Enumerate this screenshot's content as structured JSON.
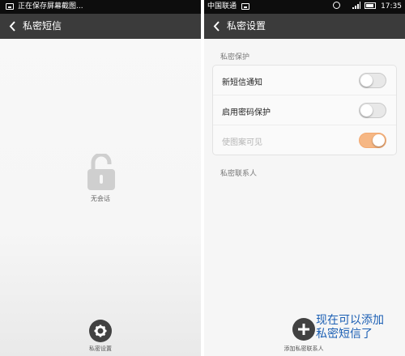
{
  "left": {
    "status_text": "正在保存屏幕截图...",
    "title": "私密短信",
    "empty_label": "无会话",
    "settings_label": "私密设置",
    "icons": {
      "lock": "unlocked-padlock-icon",
      "settings": "gear-icon",
      "back": "chevron-left-icon"
    }
  },
  "right": {
    "carrier": "中国联通",
    "time": "17:35",
    "title": "私密设置",
    "section_privacy": "私密保护",
    "toggles": [
      {
        "label": "新短信通知",
        "state": "off",
        "enabled": true
      },
      {
        "label": "启用密码保护",
        "state": "off",
        "enabled": true
      },
      {
        "label": "使图案可见",
        "state": "on",
        "enabled": false
      }
    ],
    "section_contacts": "私密联系人",
    "add_label": "添加私密联系人",
    "accent_color": "#f6b784"
  },
  "caption": {
    "line1": "现在可以添加",
    "line2": "私密短信了"
  }
}
